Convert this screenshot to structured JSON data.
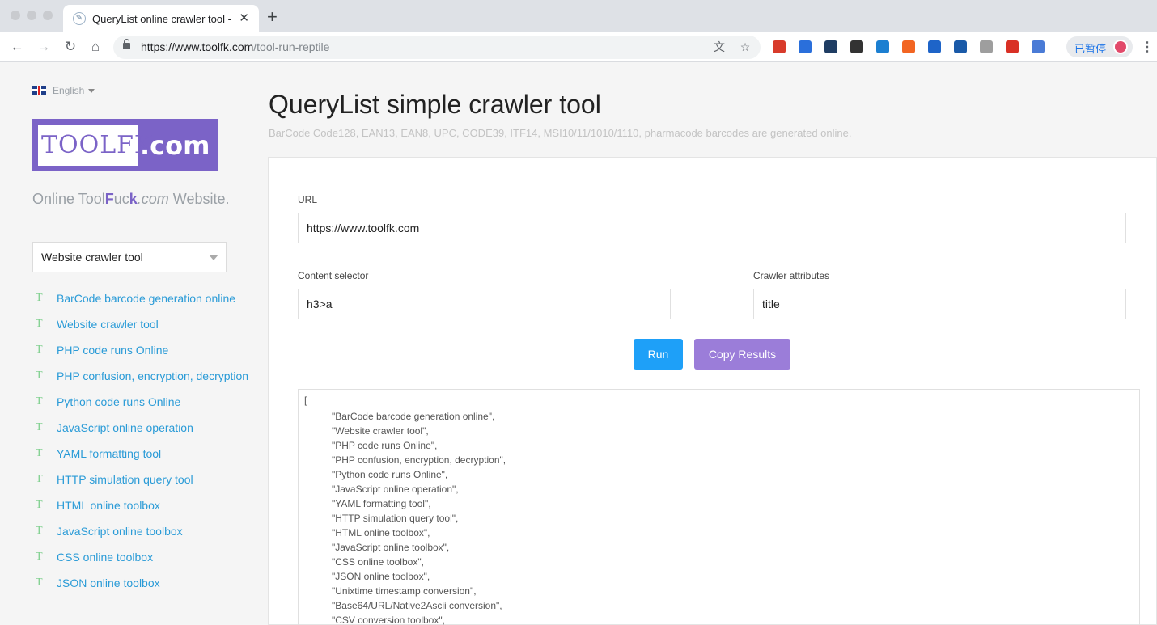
{
  "browser": {
    "tab_title": "QueryList online crawler tool - ",
    "tab_close": "✕",
    "new_tab": "+",
    "url_host": "https://www.toolfk.com",
    "url_path": "/tool-run-reptile",
    "profile_label": "已暂停",
    "nav": {
      "back": "←",
      "forward": "→",
      "reload": "↻",
      "home": "⌂"
    },
    "omnibox_icons": {
      "translate": "文",
      "bookmark": "☆"
    },
    "extension_colors": [
      "#d83b2b",
      "#2a6fdb",
      "#1f3d63",
      "#333333",
      "#1c7fd1",
      "#f26522",
      "#1e64c8",
      "#1a5aa8",
      "#9e9e9e",
      "#d93025",
      "#4a7bd6"
    ]
  },
  "sidebar": {
    "language": "English",
    "logo_tool": "TOOLFK",
    "logo_com": ".com",
    "slogan": {
      "a": "Online Tool",
      "b": "F",
      "c": "uc",
      "d": "k",
      "e": ".com",
      "f": " Website."
    },
    "select_value": "Website crawler tool",
    "tools": [
      "BarCode barcode generation online",
      "Website crawler tool",
      "PHP code runs Online",
      "PHP confusion, encryption, decryption",
      "Python code runs Online",
      "JavaScript online operation",
      "YAML formatting tool",
      "HTTP simulation query tool",
      "HTML online toolbox",
      "JavaScript online toolbox",
      "CSS online toolbox",
      "JSON online toolbox"
    ]
  },
  "main": {
    "title": "QueryList simple crawler tool",
    "subtitle": "BarCode Code128, EAN13, EAN8, UPC, CODE39, ITF14, MSI10/11/1010/1110, pharmacode barcodes are generated online.",
    "url_label": "URL",
    "url_value": "https://www.toolfk.com",
    "selector_label": "Content selector",
    "selector_value": "h3>a",
    "attr_label": "Crawler attributes",
    "attr_value": "title",
    "run_label": "Run",
    "copy_label": "Copy Results",
    "result_open": "[",
    "result_lines": [
      "\"BarCode barcode generation online\",",
      "\"Website crawler tool\",",
      "\"PHP code runs Online\",",
      "\"PHP confusion, encryption, decryption\",",
      "\"Python code runs Online\",",
      "\"JavaScript online operation\",",
      "\"YAML formatting tool\",",
      "\"HTTP simulation query tool\",",
      "\"HTML online toolbox\",",
      "\"JavaScript online toolbox\",",
      "\"CSS online toolbox\",",
      "\"JSON online toolbox\",",
      "\"Unixtime timestamp conversion\",",
      "\"Base64/URL/Native2Ascii conversion\",",
      "\"CSV conversion toolbox\","
    ]
  }
}
